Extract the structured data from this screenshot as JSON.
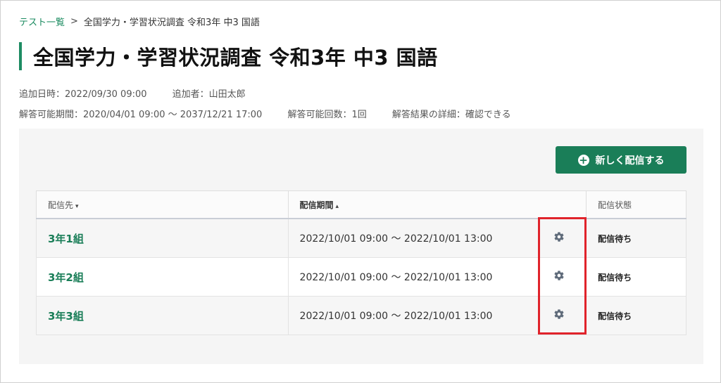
{
  "breadcrumb": {
    "parent": "テスト一覧",
    "separator": ">",
    "current": "全国学力・学習状況調査 令和3年 中3 国語"
  },
  "page_title": "全国学力・学習状況調査 令和3年 中3 国語",
  "meta": {
    "added_date": "追加日時：2022/09/30 09:00",
    "added_by": "追加者：山田太郎",
    "answer_period": "解答可能期間：2020/04/01 09:00 〜 2037/12/21 17:00",
    "answer_count": "解答可能回数：1回",
    "result_detail": "解答結果の詳細：確認できる"
  },
  "new_button": {
    "icon": "plus-circle-icon",
    "label": "新しく配信する"
  },
  "table": {
    "headers": {
      "target": "配信先",
      "target_sort": "▾",
      "period": "配信期間",
      "period_sort": "▴",
      "status": "配信状態"
    },
    "rows": [
      {
        "group": "3年1組",
        "period": "2022/10/01 09:00 〜 2022/10/01 13:00",
        "icon": "gear-icon",
        "status": "配信待ち"
      },
      {
        "group": "3年2組",
        "period": "2022/10/01 09:00 〜 2022/10/01 13:00",
        "icon": "gear-icon",
        "status": "配信待ち"
      },
      {
        "group": "3年3組",
        "period": "2022/10/01 09:00 〜 2022/10/01 13:00",
        "icon": "gear-icon",
        "status": "配信待ち"
      }
    ]
  },
  "colors": {
    "accent": "#1a7e58",
    "highlight": "#e0232b"
  }
}
